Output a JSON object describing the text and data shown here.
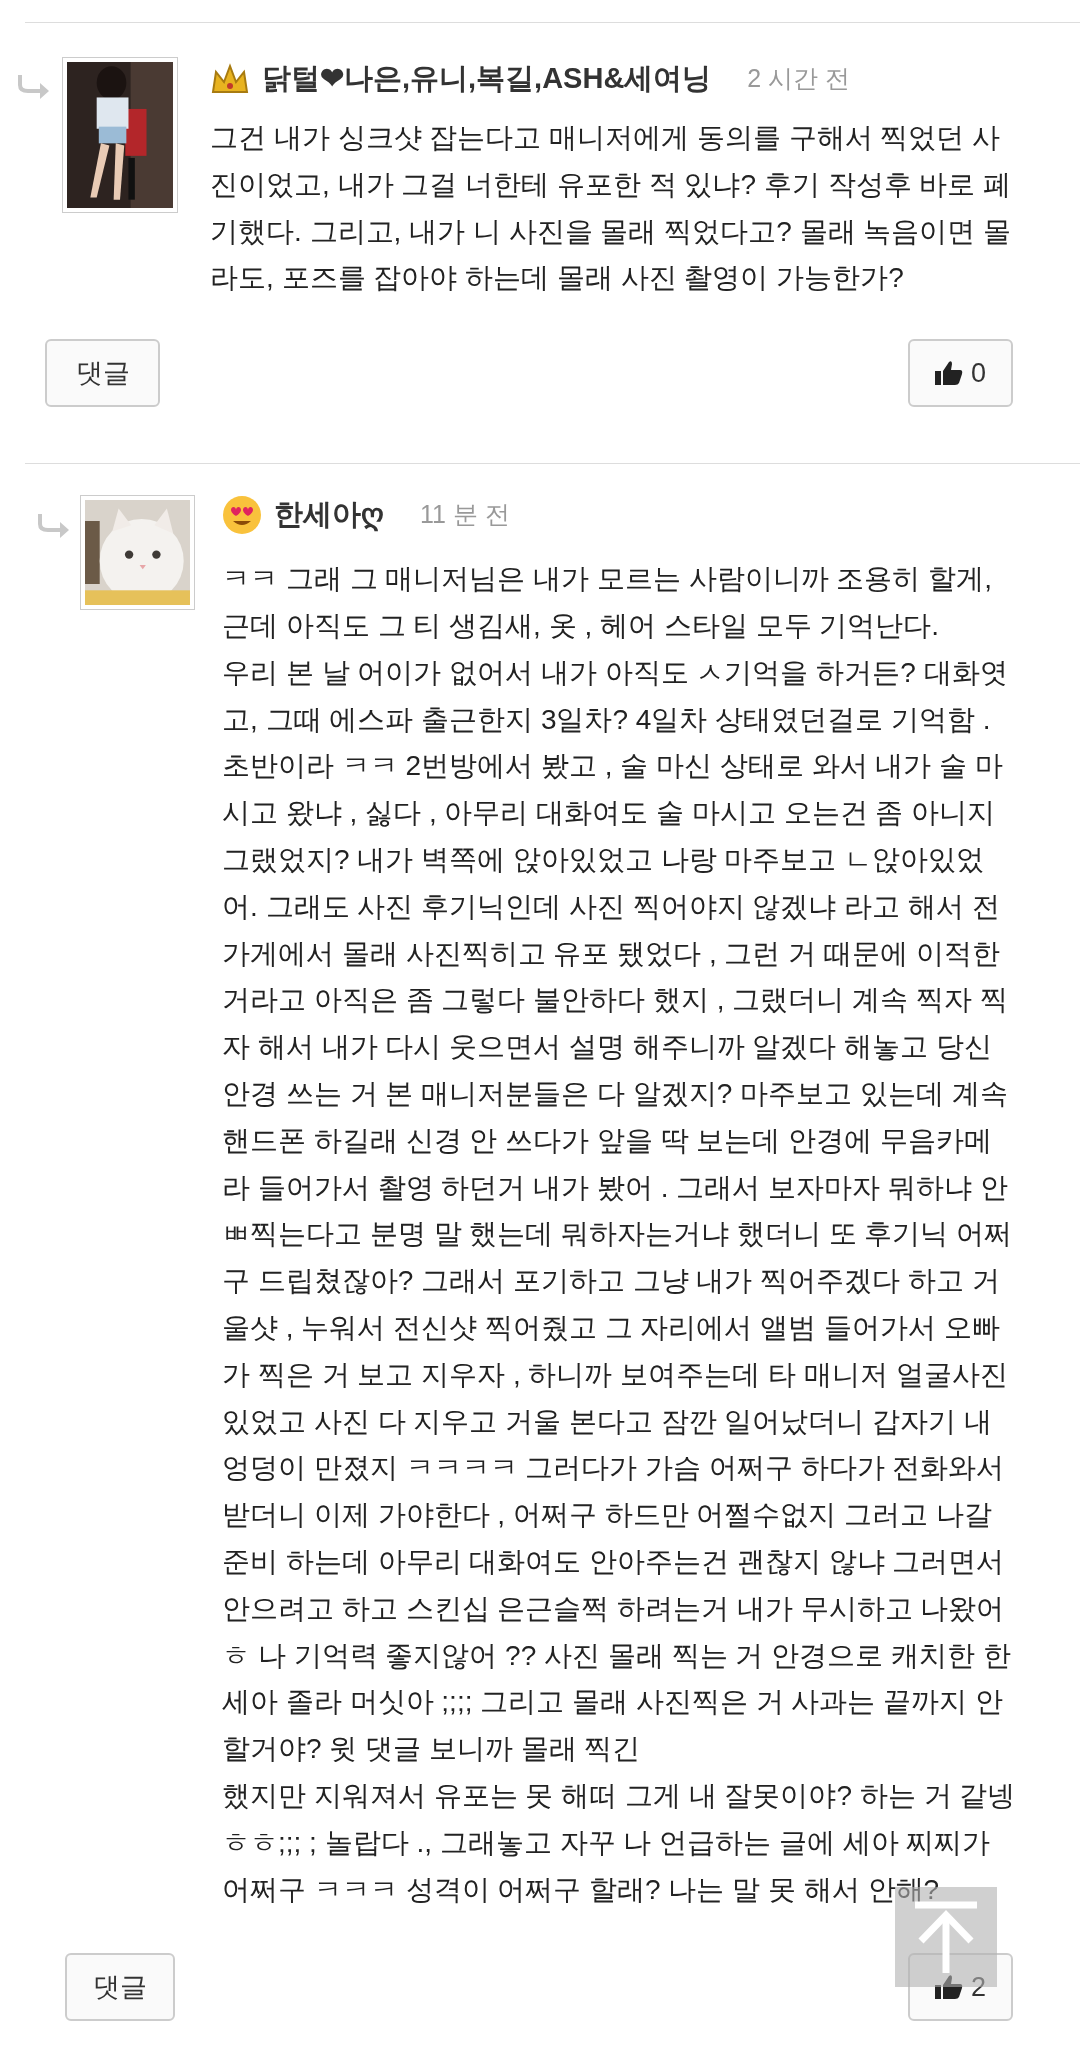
{
  "comments": [
    {
      "author": "닭털❤나은,유니,복길,ASH&세여닝",
      "time": "2 시간 전",
      "text": "그건 내가 싱크샷 잡는다고 매니저에게 동의를 구해서 찍었던 사\n진이었고, 내가 그걸 너한테 유포한 적 있냐? 후기 작성후 바로 폐\n기했다. 그리고, 내가 니 사진을 몰래 찍었다고? 몰래 녹음이면 몰\n라도, 포즈를 잡아야 하는데 몰래 사진 촬영이 가능한가?",
      "reply_button": "댓글",
      "likes": "0"
    },
    {
      "author": "한세아ღ",
      "time": "11 분 전",
      "text": "ㅋㅋ 그래 그 매니저님은 내가 모르는 사람이니까 조용히 할게,\n근데 아직도 그 티 생김새, 옷 , 헤어 스타일 모두 기억난다.\n우리 본 날 어이가 없어서 내가 아직도 ㅅ기억을 하거든? 대화엿\n고, 그때 에스파 출근한지 3일차? 4일차 상태였던걸로 기억함 .\n초반이라 ㅋㅋ 2번방에서 봤고 , 술 마신 상태로 와서 내가 술 마\n시고 왔냐 , 싫다 , 아무리 대화여도 술 마시고 오는건 좀 아니지\n그랬었지? 내가 벽쪽에 앉아있었고 나랑 마주보고 ㄴ앉아있었\n어. 그래도 사진 후기닉인데 사진 찍어야지 않겠냐 라고 해서 전\n가게에서 몰래 사진찍히고 유포 됐었다 , 그런 거 때문에 이적한\n거라고 아직은 좀 그렇다 불안하다 했지 , 그랬더니 계속 찍자 찍\n자 해서 내가 다시 웃으면서 설명 해주니까 알겠다 해놓고 당신\n안경 쓰는 거 본 매니저분들은 다 알겠지? 마주보고 있는데 계속\n핸드폰 하길래 신경 안 쓰다가 앞을 딱 보는데 안경에 무음카메\n라 들어가서 촬영 하던거 내가 봤어 . 그래서 보자마자 뭐하냐 안\nㅃ찍는다고 분명 말 했는데 뭐하자는거냐 했더니 또 후기닉 어쩌\n구 드립쳤잖아? 그래서 포기하고 그냥 내가 찍어주겠다 하고 거\n울샷 , 누워서 전신샷 찍어줬고 그 자리에서 앨범 들어가서 오빠\n가 찍은 거 보고 지우자 , 하니까 보여주는데 타 매니저 얼굴사진\n있었고 사진 다 지우고 거울 본다고 잠깐 일어났더니 갑자기 내\n엉덩이 만졌지 ㅋㅋㅋㅋ 그러다가 가슴 어쩌구 하다가 전화와서\n받더니 이제 가야한다 , 어쩌구 하드만 어쩔수없지 그러고 나갈\n준비 하는데 아무리 대화여도 안아주는건 괜찮지 않냐 그러면서\n안으려고 하고 스킨십 은근슬쩍 하려는거 내가 무시하고 나왔어\nㅎ 나 기억력 좋지않어 ?? 사진 몰래 찍는 거 안경으로 캐치한 한\n세아 졸라 머싯아 ;;;; 그리고 몰래 사진찍은 거 사과는 끝까지 안\n할거야? 윗 댓글 보니까 몰래 찍긴\n했지만 지워져서 유포는 못 해떠 그게 내 잘못이야? 하는 거 같넹\nㅎㅎ;;; ; 놀랍다 ., 그래놓고 자꾸 나 언급하는 글에 세아 찌찌가\n어쩌구 ㅋㅋㅋ 성격이 어쩌구 할래? 나는 말 못 해서 안해?",
      "reply_button": "댓글",
      "likes": "2"
    }
  ]
}
